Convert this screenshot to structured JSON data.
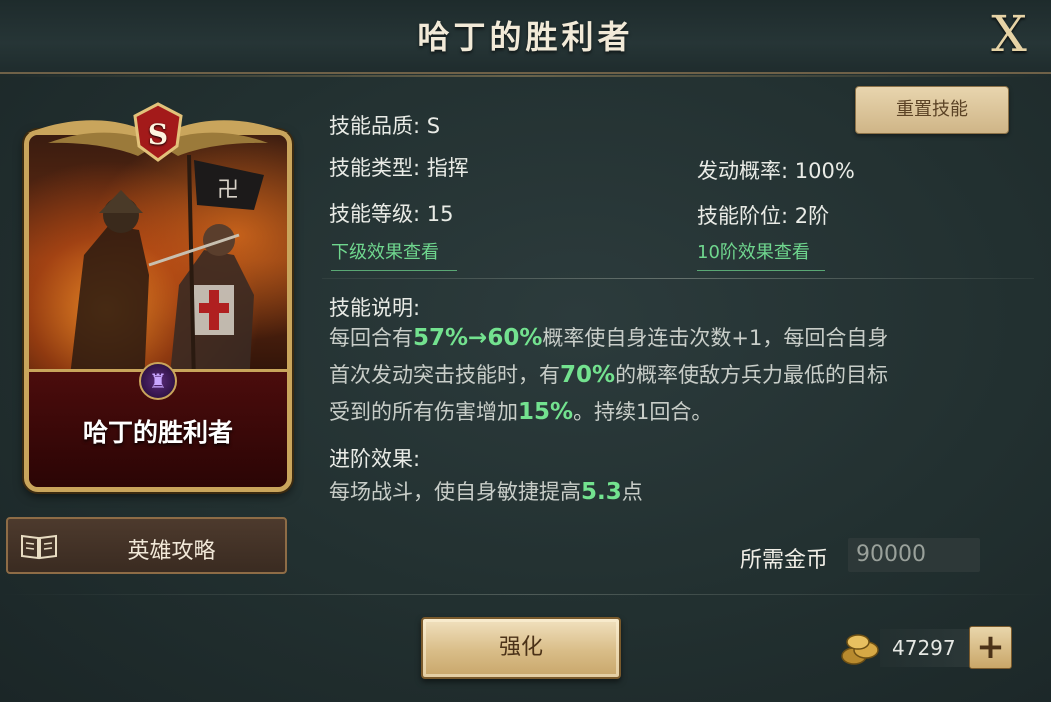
{
  "header": {
    "title": "哈丁的胜利者",
    "close_label": "X"
  },
  "card": {
    "grade": "S",
    "name": "哈丁的胜利者",
    "emblem": "crest-icon"
  },
  "guide_button": {
    "label": "英雄攻略",
    "icon": "book-icon"
  },
  "reset_button": {
    "label": "重置技能"
  },
  "info": {
    "quality": "技能品质: S",
    "type": "技能类型: 指挥",
    "level": "技能等级: 15",
    "trigger_rate": "发动概率: 100%",
    "tier": "技能阶位: 2阶",
    "next_level_link": "下级效果查看",
    "tier10_link": "10阶效果查看"
  },
  "description": {
    "title": "技能说明:",
    "line1_a": "每回合有",
    "line1_hl": "57%→60%",
    "line1_b": "概率使自身连击次数+1，每回合自身",
    "line2_a": "首次发动突击技能时，有",
    "line2_hl": "70%",
    "line2_b": "的概率使敌方兵力最低的目标",
    "line3_a": "受到的所有伤害增加",
    "line3_hl": "15%",
    "line3_b": "。持续1回合。"
  },
  "advance": {
    "title": "进阶效果:",
    "text_a": "每场战斗，使自身敏捷提高",
    "text_hl": "5.3",
    "text_b": "点"
  },
  "cost": {
    "label": "所需金币",
    "value": "90000"
  },
  "upgrade_button": {
    "label": "强化"
  },
  "gold": {
    "amount": "47297",
    "icon": "gold-coins-icon",
    "add_label": "+"
  },
  "colors": {
    "highlight": "#73e28f",
    "link": "#6fd68e",
    "gold": "#c9a55c"
  }
}
